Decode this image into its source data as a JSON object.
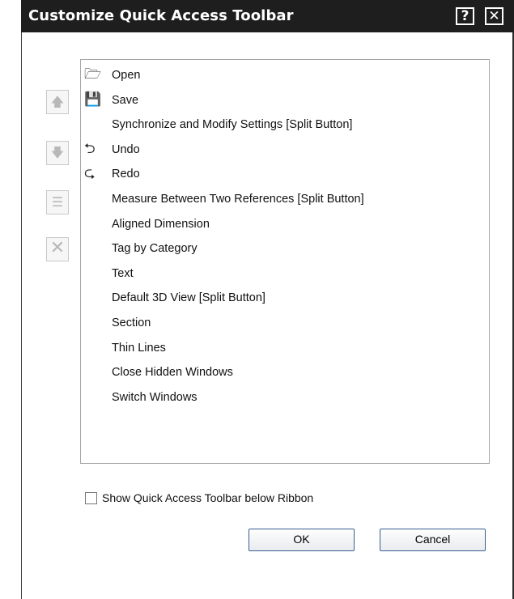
{
  "window": {
    "title": "Customize Quick Access Toolbar",
    "help_label": "?",
    "close_label": "✕"
  },
  "side_buttons": {
    "move_up": "🡅",
    "move_down": "🡇",
    "add_separator": "☰",
    "remove": "✕"
  },
  "list": {
    "items": [
      {
        "label": "Open",
        "icon": "open-folder-icon",
        "glyph": "🗁"
      },
      {
        "label": "Save",
        "icon": "save-icon",
        "glyph": "💾"
      },
      {
        "label": "Synchronize and Modify Settings [Split Button]",
        "icon": "",
        "glyph": ""
      },
      {
        "label": "Undo",
        "icon": "undo-icon",
        "glyph": "⮌"
      },
      {
        "label": "Redo",
        "icon": "redo-icon",
        "glyph": "⮎"
      },
      {
        "label": "Measure Between Two References [Split Button]",
        "icon": "",
        "glyph": ""
      },
      {
        "label": "Aligned Dimension",
        "icon": "",
        "glyph": ""
      },
      {
        "label": "Tag by Category",
        "icon": "",
        "glyph": ""
      },
      {
        "label": "Text",
        "icon": "",
        "glyph": ""
      },
      {
        "label": "Default 3D View [Split Button]",
        "icon": "",
        "glyph": ""
      },
      {
        "label": "Section",
        "icon": "",
        "glyph": ""
      },
      {
        "label": "Thin Lines",
        "icon": "",
        "glyph": ""
      },
      {
        "label": "Close Hidden Windows",
        "icon": "",
        "glyph": ""
      },
      {
        "label": "Switch Windows",
        "icon": "",
        "glyph": ""
      }
    ]
  },
  "checkbox": {
    "label": "Show Quick Access Toolbar below Ribbon",
    "checked": false
  },
  "buttons": {
    "ok": "OK",
    "cancel": "Cancel"
  }
}
